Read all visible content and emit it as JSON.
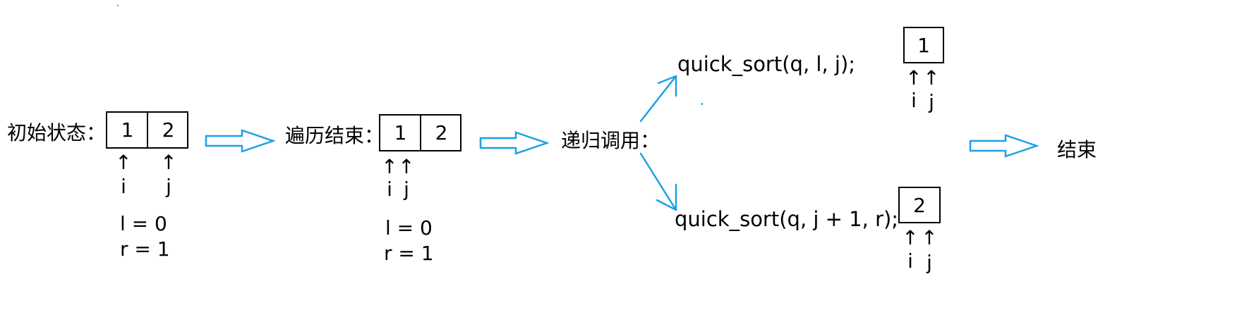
{
  "colors": {
    "arrow": "#1ea0e6",
    "line": "#000000"
  },
  "stage1": {
    "label": "初始状态：",
    "cells": [
      "1",
      "2"
    ],
    "ptr_i": "↑",
    "ptr_j": "↑",
    "i": "i",
    "j": "j",
    "l_line": "l = 0",
    "r_line": "r = 1"
  },
  "stage2": {
    "label": "遍历结束：",
    "cells": [
      "1",
      "2"
    ],
    "ptr_i": "↑",
    "ptr_j": "↑",
    "i": "i",
    "j": "j",
    "l_line": "l = 0",
    "r_line": "r = 1"
  },
  "stage3": {
    "label": "递归调用："
  },
  "upper": {
    "call": "quick_sort(q, l, j);",
    "cell": "1",
    "ptr_i": "↑",
    "ptr_j": "↑",
    "i": "i",
    "j": "j"
  },
  "lower": {
    "call": "quick_sort(q, j + 1, r);",
    "cell": "2",
    "ptr_i": "↑",
    "ptr_j": "↑",
    "i": "i",
    "j": "j"
  },
  "end": {
    "label": "结束"
  }
}
